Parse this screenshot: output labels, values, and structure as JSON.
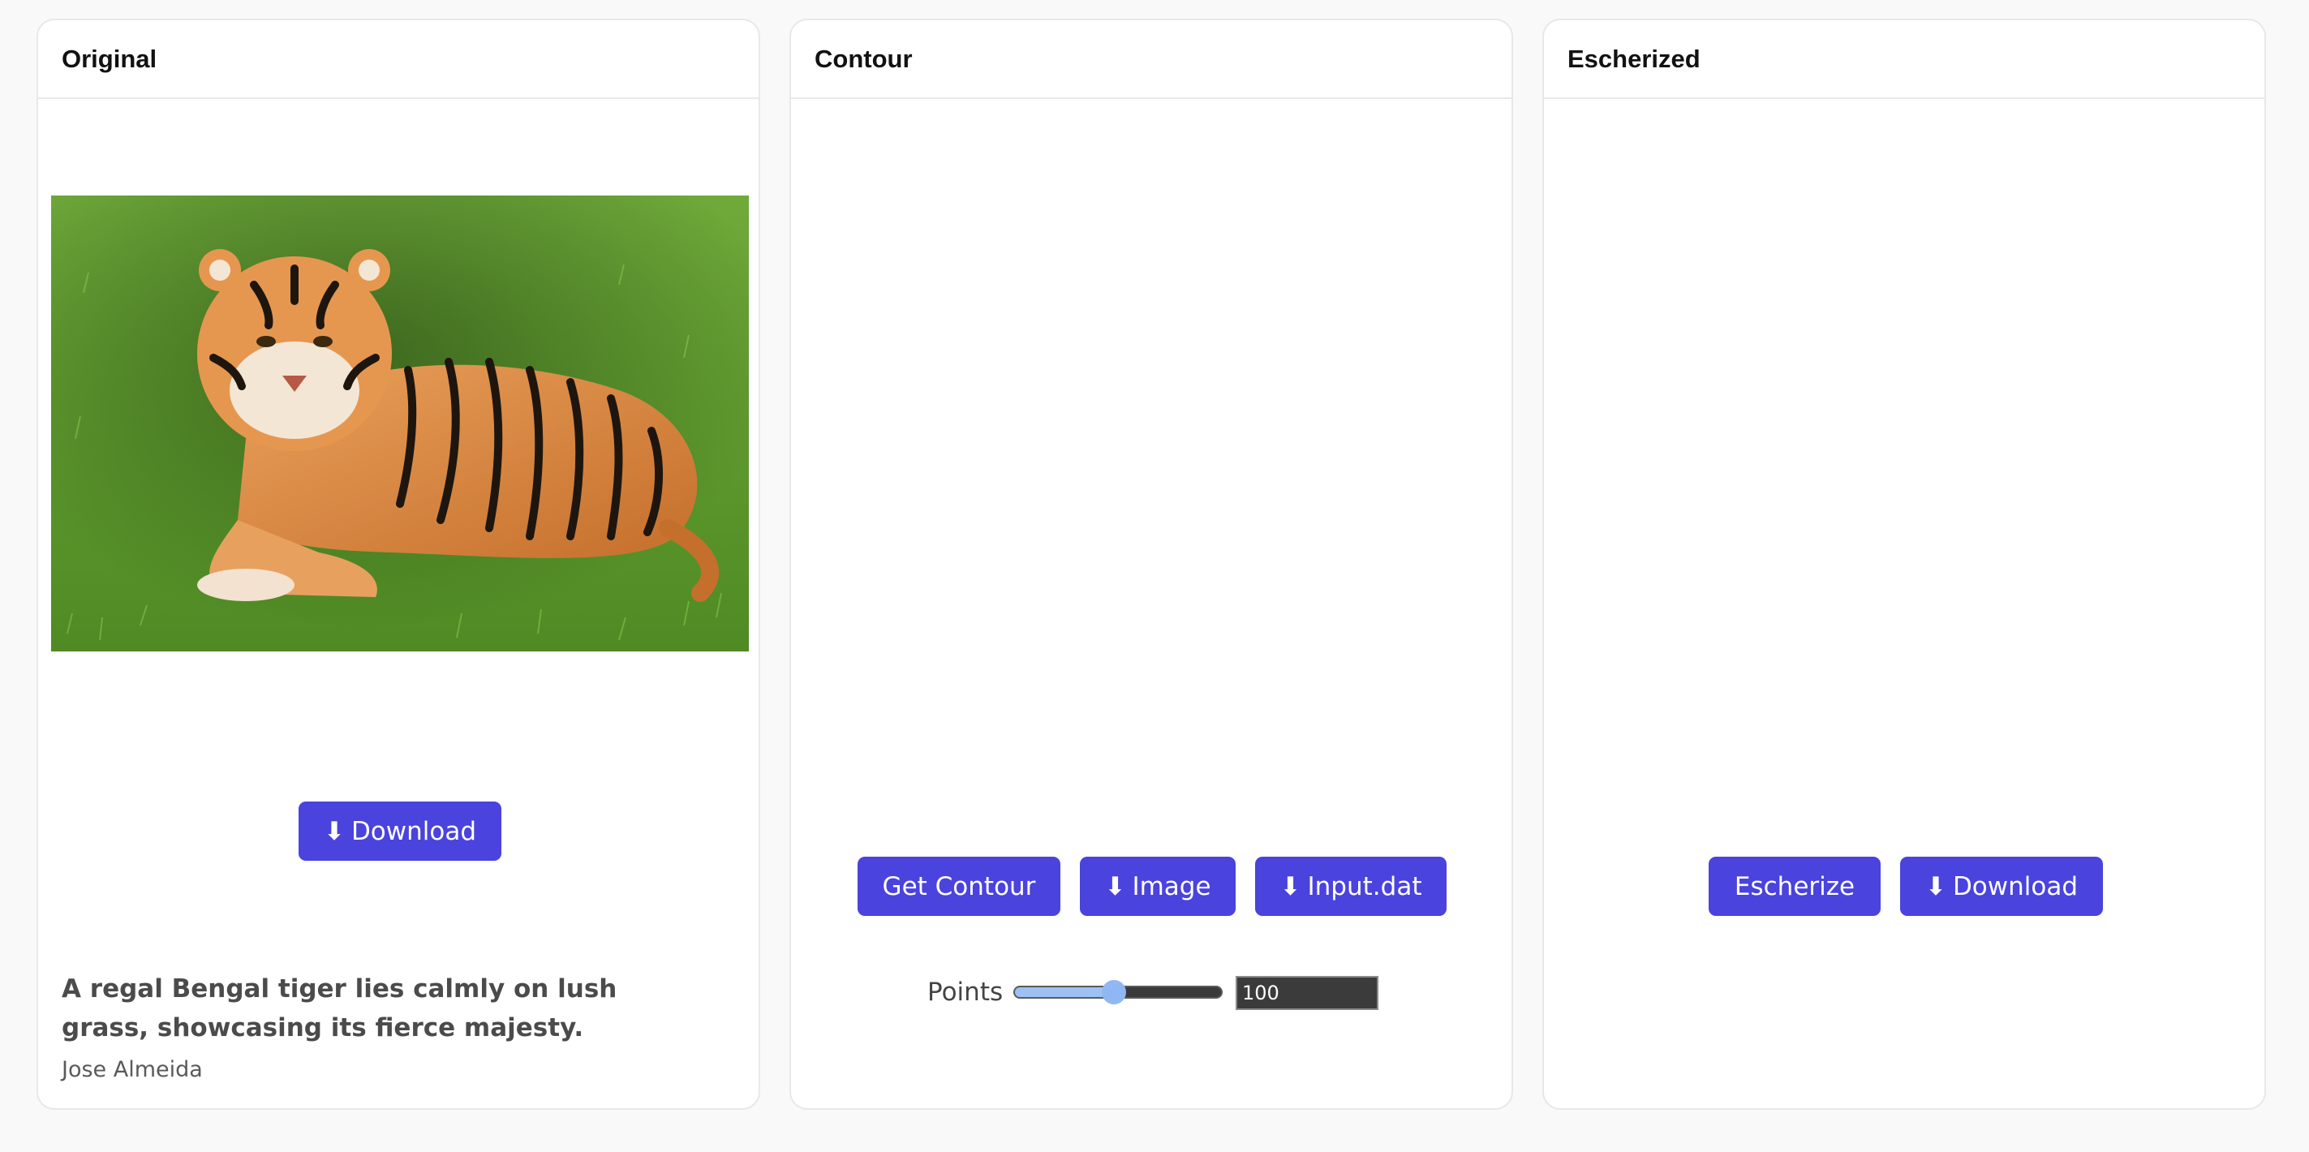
{
  "panels": {
    "original": {
      "title": "Original",
      "download_icon": "download-arrow-icon",
      "download_glyph": "⬇",
      "download_label": "Download",
      "caption": "A regal Bengal tiger lies calmly on lush grass, showcasing its fierce majesty.",
      "author": "Jose Almeida"
    },
    "contour": {
      "title": "Contour",
      "get_contour_label": "Get Contour",
      "image_glyph": "⬇",
      "image_label": "Image",
      "input_dat_glyph": "⬇",
      "input_dat_label": "Input.dat",
      "points_label": "Points",
      "points_value": "100",
      "points_slider_fraction": 0.48
    },
    "escherized": {
      "title": "Escherized",
      "escherize_label": "Escherize",
      "download_glyph": "⬇",
      "download_label": "Download"
    }
  },
  "colors": {
    "accent": "#4a43dd",
    "background": "#f9f9f9",
    "card": "#ffffff",
    "slider_fill": "#9ec1f4",
    "grass": "#5c9a2c",
    "tiger": "#d9833a"
  }
}
